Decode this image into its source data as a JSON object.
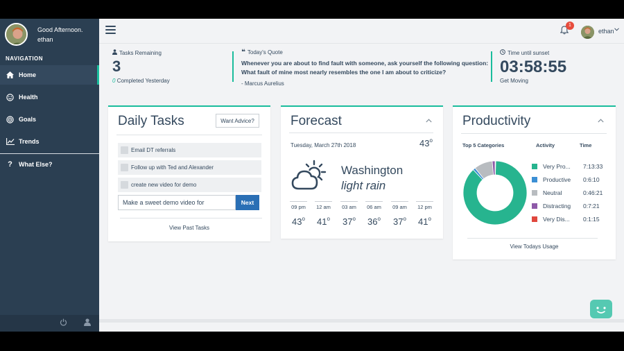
{
  "sidebar": {
    "greeting": "Good Afternoon.",
    "username": "ethan",
    "nav_heading": "NAVIGATION",
    "items": [
      {
        "label": "Home",
        "icon": "home-icon"
      },
      {
        "label": "Health",
        "icon": "smiley-icon"
      },
      {
        "label": "Goals",
        "icon": "target-icon"
      },
      {
        "label": "Trends",
        "icon": "line-chart-icon"
      }
    ],
    "extra": {
      "label": "What Else?",
      "icon": "question-icon"
    }
  },
  "topbar": {
    "notification_count": "1",
    "username": "ethan"
  },
  "stats": {
    "tasks_label": "Tasks Remaining",
    "tasks_count": "3",
    "completed_count": "0",
    "completed_label": "Completed Yesterday",
    "quote_label": "Today's Quote",
    "quote_text": "Whenever you are about to find fault with someone, ask yourself the following question: What fault of mine most nearly resembles the one I am about to criticize?",
    "quote_author": "- Marcus Aurelius",
    "sunset_label": "Time until sunset",
    "sunset_time": "03:58:55",
    "sunset_sub": "Get Moving"
  },
  "daily_tasks": {
    "title": "Daily Tasks",
    "advice_button": "Want Advice?",
    "tasks": [
      "Email DT referrals",
      "Follow up with Ted and Alexander",
      "create new video for demo"
    ],
    "input_value": "Make a sweet demo video for",
    "next_button": "Next",
    "view_past": "View Past Tasks"
  },
  "forecast": {
    "title": "Forecast",
    "date": "Tuesday, March 27th 2018",
    "current_temp": "43",
    "degree": "o",
    "city": "Washington",
    "condition": "light rain",
    "hours": [
      {
        "time": "09 pm",
        "temp": "43"
      },
      {
        "time": "12 am",
        "temp": "41"
      },
      {
        "time": "03 am",
        "temp": "37"
      },
      {
        "time": "06 am",
        "temp": "36"
      },
      {
        "time": "09 am",
        "temp": "37"
      },
      {
        "time": "12 pm",
        "temp": "41"
      }
    ]
  },
  "productivity": {
    "title": "Productivity",
    "col_categories": "Top 5 Categories",
    "col_activity": "Activity",
    "col_time": "Time",
    "view_usage": "View Todays Usage",
    "categories": [
      {
        "label": "Very Pro...",
        "time": "7:13:33",
        "seconds": 26013,
        "color": "#27b48f"
      },
      {
        "label": "Productive",
        "time": "0:6:10",
        "seconds": 370,
        "color": "#3b8fd4"
      },
      {
        "label": "Neutral",
        "time": "0:46:21",
        "seconds": 2781,
        "color": "#b8bcc0"
      },
      {
        "label": "Distracting",
        "time": "0:7:21",
        "seconds": 441,
        "color": "#8e5aa8"
      },
      {
        "label": "Very Dis...",
        "time": "0:1:15",
        "seconds": 75,
        "color": "#e0483e"
      }
    ]
  },
  "colors": {
    "accent": "#1abc9c",
    "sidebar": "#2b3f52",
    "primary_button": "#2a6fb5"
  }
}
